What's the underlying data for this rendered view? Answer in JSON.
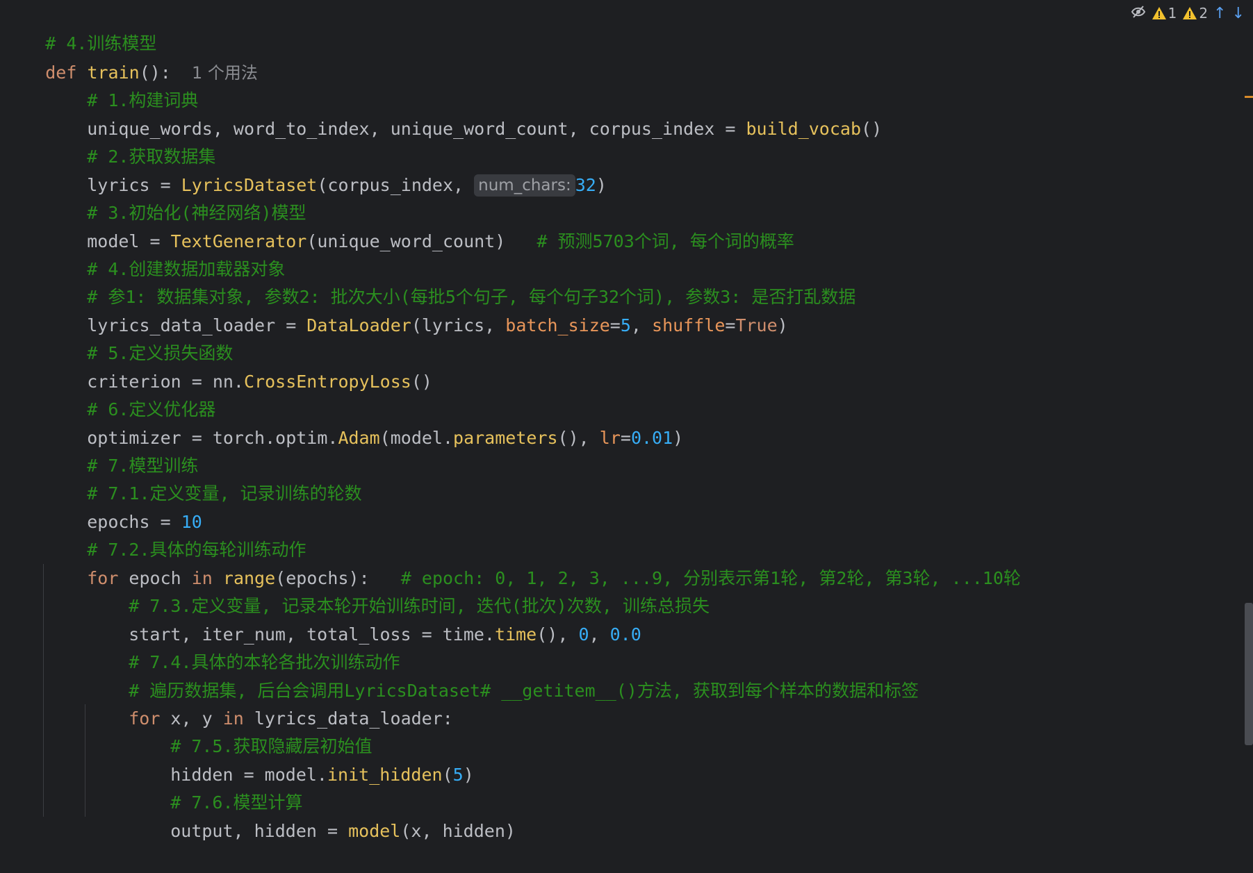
{
  "indicators": {
    "warning_count_1": "1",
    "warning_count_2": "2"
  },
  "code": {
    "l1": {
      "comment": "# 4.训练模型"
    },
    "l2": {
      "kw": "def",
      "name": "train",
      "punct": "():",
      "usage": "1 个用法"
    },
    "l3": {
      "comment": "# 1.构建词典"
    },
    "l4": {
      "lhs": "unique_words, word_to_index, unique_word_count, corpus_index = ",
      "call": "build_vocab",
      "tail": "()"
    },
    "l5": {
      "comment": "# 2.获取数据集"
    },
    "l6": {
      "lhs": "lyrics = ",
      "call": "LyricsDataset",
      "args": "(corpus_index, ",
      "hint": "num_chars:",
      "num": "32",
      "tail": ")"
    },
    "l7": {
      "comment": "# 3.初始化(神经网络)模型"
    },
    "l8": {
      "lhs": "model = ",
      "call": "TextGenerator",
      "args": "(unique_word_count)",
      "comment": "# 预测5703个词, 每个词的概率"
    },
    "l9": {
      "comment": "# 4.创建数据加载器对象"
    },
    "l10": {
      "comment": "# 参1: 数据集对象, 参数2: 批次大小(每批5个句子, 每个句子32个词), 参数3: 是否打乱数据"
    },
    "l11": {
      "lhs": "lyrics_data_loader = ",
      "call": "DataLoader",
      "args": "(lyrics, ",
      "param1": "batch_size",
      "eq1": "=",
      "num1": "5",
      "sep": ", ",
      "param2": "shuffle",
      "eq2": "=",
      "kwval": "True",
      "tail": ")"
    },
    "l12": {
      "comment": "# 5.定义损失函数"
    },
    "l13": {
      "lhs": "criterion = nn.",
      "call": "CrossEntropyLoss",
      "tail": "()"
    },
    "l14": {
      "comment": "# 6.定义优化器"
    },
    "l15": {
      "lhs": "optimizer = torch.optim.",
      "call": "Adam",
      "args": "(model.",
      "call2": "parameters",
      "mid": "(), ",
      "param": "lr",
      "eq": "=",
      "num": "0.01",
      "tail": ")"
    },
    "l16": {
      "comment": "# 7.模型训练"
    },
    "l17": {
      "comment": "# 7.1.定义变量, 记录训练的轮数"
    },
    "l18": {
      "lhs": "epochs = ",
      "num": "10"
    },
    "l19": {
      "comment": "# 7.2.具体的每轮训练动作"
    },
    "l20": {
      "kw1": "for",
      "var": " epoch ",
      "kw2": "in",
      "sp": " ",
      "call": "range",
      "args": "(epochs):",
      "comment": "# epoch: 0, 1, 2, 3, ...9, 分别表示第1轮, 第2轮, 第3轮, ...10轮"
    },
    "l21": {
      "comment": "# 7.3.定义变量, 记录本轮开始训练时间, 迭代(批次)次数, 训练总损失"
    },
    "l22": {
      "lhs": "start, iter_num, total_loss = time.",
      "call": "time",
      "mid": "(), ",
      "num1": "0",
      "sep": ", ",
      "num2": "0.0"
    },
    "l23": {
      "comment": "# 7.4.具体的本轮各批次训练动作"
    },
    "l24": {
      "comment": "# 遍历数据集, 后台会调用LyricsDataset# __getitem__()方法, 获取到每个样本的数据和标签"
    },
    "l25": {
      "kw1": "for",
      "var": " x, y ",
      "kw2": "in",
      "rest": " lyrics_data_loader:"
    },
    "l26": {
      "comment": "# 7.5.获取隐藏层初始值"
    },
    "l27": {
      "lhs": "hidden = model.",
      "call": "init_hidden",
      "open": "(",
      "num": "5",
      "tail": ")"
    },
    "l28": {
      "comment": "# 7.6.模型计算"
    },
    "l29": {
      "lhs": "output, hidden = ",
      "call": "model",
      "args": "(x, hidden)"
    }
  }
}
